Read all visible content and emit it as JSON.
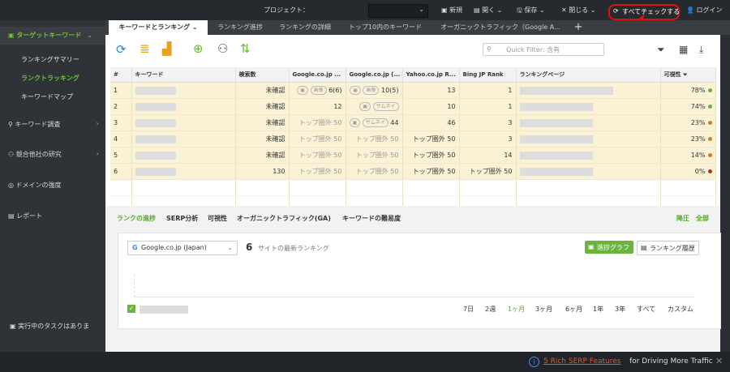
{
  "topbar": {
    "project_label": "プロジェクト：",
    "new_label": "新規",
    "open_label": "開く",
    "save_label": "保存",
    "close_label": "閉じる",
    "check_all_label": "すべてチェックする",
    "login_label": "ログイン"
  },
  "sidebar": {
    "section": "ターゲットキーワード",
    "subitems": [
      "ランキングサマリー",
      "ランクトラッキング",
      "キーワードマップ"
    ],
    "items": [
      "キーワード調査",
      "競合他社の研究",
      "ドメインの強度",
      "レポート"
    ],
    "task": "実行中のタスクはありま"
  },
  "tabs": [
    "キーワードとランキング",
    "ランキング進捗",
    "ランキングの詳細",
    "トップ10内のキーワード",
    "オーガニックトラフィック（Google A...",
    "+"
  ],
  "filter": {
    "placeholder": "Quick Filter: 含有"
  },
  "table": {
    "headers": [
      "#",
      "キーワード",
      "検索数",
      "Google.co.jp ...",
      "Google.co.jp (...",
      "Yahoo.co.jp R...",
      "Bing JP Rank",
      "ランキングページ",
      "可視性"
    ],
    "rows": [
      {
        "num": "1",
        "vol": "未確認",
        "g1_tag": "画像",
        "g1": "6(6)",
        "g2_tag": "画像",
        "g2": "10(5)",
        "yahoo": "13",
        "bing": "1",
        "vis": "78%",
        "dot": "#6ab33d"
      },
      {
        "num": "2",
        "vol": "未確認",
        "g1_tag": "",
        "g1": "12",
        "g2_tag": "サムネイ",
        "g2": "",
        "yahoo": "10",
        "bing": "1",
        "vis": "74%",
        "dot": "#6ab33d"
      },
      {
        "num": "3",
        "vol": "未確認",
        "g1_tag": "",
        "g1": "トップ圏外 50",
        "g2_tag": "サムネイ",
        "g2": "44",
        "yahoo": "46",
        "bing": "3",
        "vis": "23%",
        "dot": "#e07b1a"
      },
      {
        "num": "4",
        "vol": "未確認",
        "g1_tag": "",
        "g1": "トップ圏外 50",
        "g2_tag": "",
        "g2": "トップ圏外 50",
        "yahoo": "トップ圏外 50",
        "bing": "3",
        "vis": "23%",
        "dot": "#e07b1a"
      },
      {
        "num": "5",
        "vol": "未確認",
        "g1_tag": "",
        "g1": "トップ圏外 50",
        "g2_tag": "",
        "g2": "トップ圏外 50",
        "yahoo": "トップ圏外 50",
        "bing": "14",
        "vis": "14%",
        "dot": "#e07b1a"
      },
      {
        "num": "6",
        "vol": "130",
        "g1_tag": "",
        "g1": "トップ圏外 50",
        "g2_tag": "",
        "g2": "トップ圏外 50",
        "yahoo": "トップ圏外 50",
        "bing": "トップ圏外 50",
        "vis": "0%",
        "dot": "#c62828"
      }
    ]
  },
  "bottom": {
    "tabs": [
      "ランクの進捗",
      "SERP分析",
      "可視性",
      "オーガニックトラフィック(GA)",
      "キーワードの難易度"
    ],
    "right_links": [
      "降圧",
      "全部"
    ],
    "engine": "Google.co.jp (Japan)",
    "count": "6",
    "count_label": "サイトの最新ランキング",
    "progress_graph": "進捗グラフ",
    "ranking_history": "ランキング履歴",
    "periods": [
      "7日",
      "2週",
      "1ヶ月",
      "3ヶ月",
      "6ヶ月",
      "1年",
      "3年",
      "すべて",
      "カスタム"
    ]
  },
  "status": {
    "link": "5 Rich SERP Features",
    "text": "for Driving More Traffic"
  },
  "colors": {
    "accent_green": "#6ab33d",
    "highlight_red": "#e01010"
  }
}
